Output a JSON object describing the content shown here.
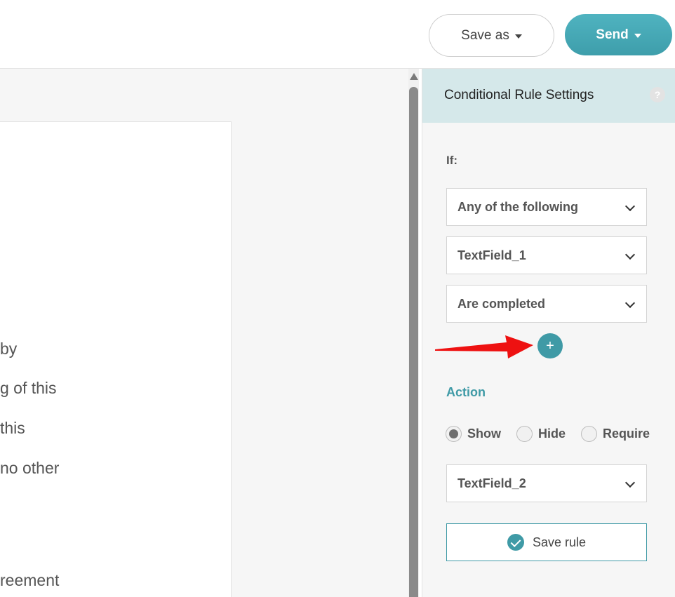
{
  "toolbar": {
    "save_as_label": "Save as",
    "send_label": "Send"
  },
  "document": {
    "lines": [
      "by",
      "g of this",
      "this",
      "no other",
      "reement"
    ]
  },
  "panel": {
    "title": "Conditional Rule Settings",
    "help_glyph": "?",
    "if_label": "If:",
    "condition_mode": "Any of the following",
    "condition_field": "TextField_1",
    "condition_state": "Are completed",
    "add_glyph": "+",
    "action_label": "Action",
    "radios": [
      {
        "label": "Show",
        "checked": true
      },
      {
        "label": "Hide",
        "checked": false
      },
      {
        "label": "Require",
        "checked": false
      }
    ],
    "target_field": "TextField_2",
    "save_rule_label": "Save rule"
  },
  "colors": {
    "accent": "#3f9aa6",
    "header_bg": "#d5e8ea",
    "annotation_arrow": "#ee1111"
  },
  "icons": {
    "save_as_caret": "chevron-down-icon",
    "send_caret": "chevron-down-icon",
    "help": "question-icon",
    "add": "plus-icon",
    "save_rule": "check-circle-icon"
  }
}
